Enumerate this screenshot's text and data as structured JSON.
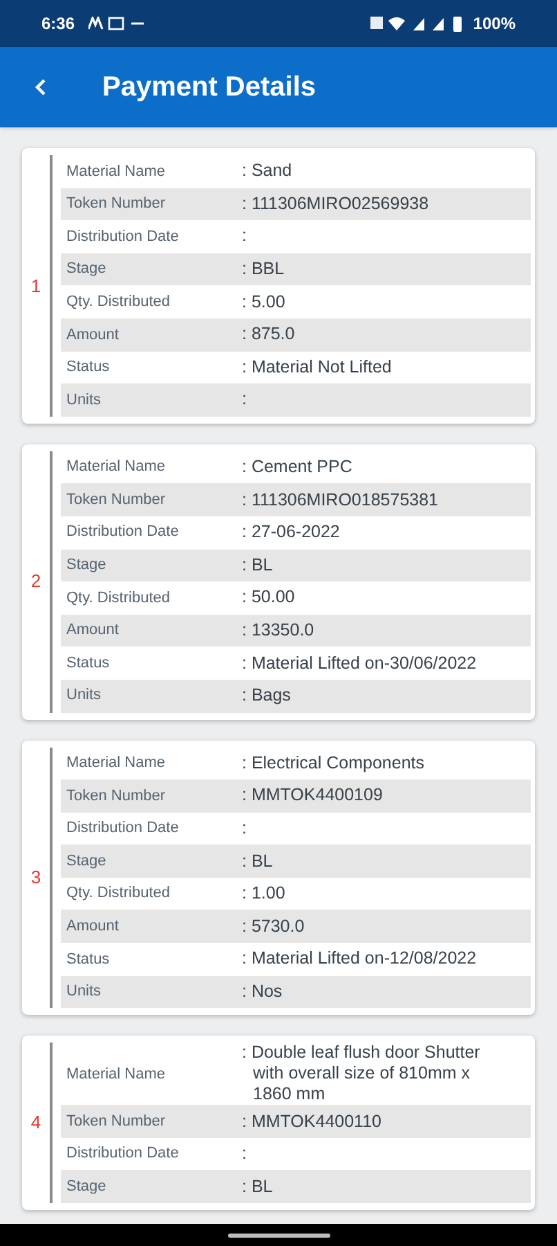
{
  "status_bar": {
    "time": "6:36",
    "battery": "100%"
  },
  "header": {
    "title": "Payment Details"
  },
  "cards": [
    {
      "number": "1",
      "rows": [
        {
          "label": "Material Name",
          "value": ": Sand"
        },
        {
          "label": "Token Number",
          "value": ": 111306MIRO02569938"
        },
        {
          "label": "Distribution Date",
          "value": ":"
        },
        {
          "label": "Stage",
          "value": ": BBL"
        },
        {
          "label": "Qty. Distributed",
          "value": ": 5.00"
        },
        {
          "label": "Amount",
          "value": ": 875.0"
        },
        {
          "label": "Status",
          "value": ": Material Not Lifted"
        },
        {
          "label": "Units",
          "value": ":"
        }
      ]
    },
    {
      "number": "2",
      "rows": [
        {
          "label": "Material Name",
          "value": ": Cement PPC"
        },
        {
          "label": "Token Number",
          "value": ": 111306MIRO018575381"
        },
        {
          "label": "Distribution Date",
          "value": ": 27-06-2022"
        },
        {
          "label": "Stage",
          "value": ": BL"
        },
        {
          "label": "Qty. Distributed",
          "value": ": 50.00"
        },
        {
          "label": "Amount",
          "value": ": 13350.0"
        },
        {
          "label": "Status",
          "value": ": Material Lifted on-30/06/2022"
        },
        {
          "label": "Units",
          "value": ": Bags"
        }
      ]
    },
    {
      "number": "3",
      "rows": [
        {
          "label": "Material Name",
          "value": ": Electrical Components"
        },
        {
          "label": "Token Number",
          "value": ": MMTOK4400109"
        },
        {
          "label": "Distribution Date",
          "value": ":"
        },
        {
          "label": "Stage",
          "value": ": BL"
        },
        {
          "label": "Qty. Distributed",
          "value": ": 1.00"
        },
        {
          "label": "Amount",
          "value": ": 5730.0"
        },
        {
          "label": "Status",
          "value": ": Material Lifted on-12/08/2022"
        },
        {
          "label": "Units",
          "value": ": Nos"
        }
      ]
    },
    {
      "number": "4",
      "rows": [
        {
          "label": "Material Name",
          "value": ": Double leaf flush door Shutter with overall size of 810mm x 1860 mm"
        },
        {
          "label": "Token Number",
          "value": ": MMTOK4400110"
        },
        {
          "label": "Distribution Date",
          "value": ":"
        },
        {
          "label": "Stage",
          "value": ": BL"
        }
      ]
    }
  ]
}
